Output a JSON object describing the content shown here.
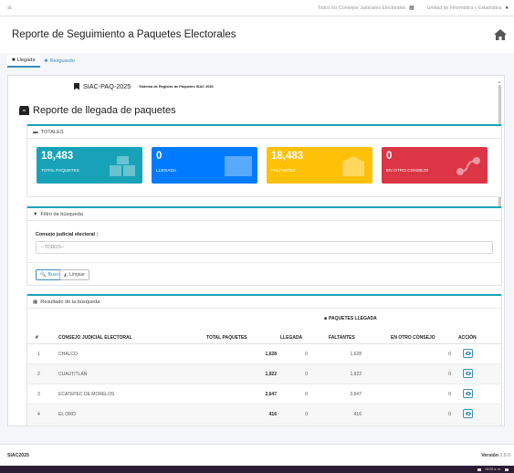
{
  "topbar": {
    "menu_icon": "≡",
    "council": "Todos los Consejos Judiciales Electorales",
    "unit": "Unidad de Informática y Estadística"
  },
  "header": {
    "title": "Reporte de Seguimiento a Paquetes Electorales"
  },
  "tabs": [
    {
      "label": "Llegada",
      "icon": "box-icon",
      "active": true
    },
    {
      "label": "Resguardo",
      "icon": "users-icon",
      "active": false
    }
  ],
  "system": {
    "code": "SIAC-PAQ-2025",
    "description": "Sistema de Registro de Paquetes SIAC 2026"
  },
  "report": {
    "title": "Reporte de llegada de paquetes"
  },
  "totals": {
    "header": "TOTALES",
    "cards": [
      {
        "value": "18,483",
        "label": "TOTAL PAQUETES",
        "color": "#17a2b8"
      },
      {
        "value": "0",
        "label": "LLEGADA",
        "color": "#007bff"
      },
      {
        "value": "18,483",
        "label": "FALTANTES",
        "color": "#ffc107"
      },
      {
        "value": "0",
        "label": "EN OTRO CONSEJO",
        "color": "#dc3545"
      }
    ]
  },
  "filter": {
    "header": "Filtro de búsqueda",
    "label": "Consejo judicial electoral :",
    "select_value": "--TODOS--",
    "buscar": "Buscar",
    "limpiar": "Limpiar"
  },
  "results": {
    "header": "Resultado de la búsqueda",
    "group_header": "PAQUETES LLEGADA",
    "columns": [
      "#",
      "CONSEJO JUDICIAL ELECTORAL",
      "TOTAL PAQUETES",
      "LLEGADA",
      "FALTANTES",
      "EN OTRO CONSEJO",
      "ACCIÓN"
    ],
    "rows": [
      {
        "n": "1",
        "consejo": "CHALCO",
        "total": "1,628",
        "llegada": "0",
        "faltantes": "1,628",
        "otro": "0"
      },
      {
        "n": "2",
        "consejo": "CUAUTITLÁN",
        "total": "1,922",
        "llegada": "0",
        "faltantes": "1,922",
        "otro": "0"
      },
      {
        "n": "3",
        "consejo": "ECATEPEC DE MORELOS",
        "total": "2,647",
        "llegada": "0",
        "faltantes": "2,647",
        "otro": "0"
      },
      {
        "n": "4",
        "consejo": "EL ORO",
        "total": "416",
        "llegada": "0",
        "faltantes": "416",
        "otro": "0"
      }
    ]
  },
  "footer": {
    "brand": "SIAC2025",
    "version_label": "Versión",
    "version": "1.0.0"
  },
  "taskbar": {
    "time": "09:00 a. m."
  }
}
